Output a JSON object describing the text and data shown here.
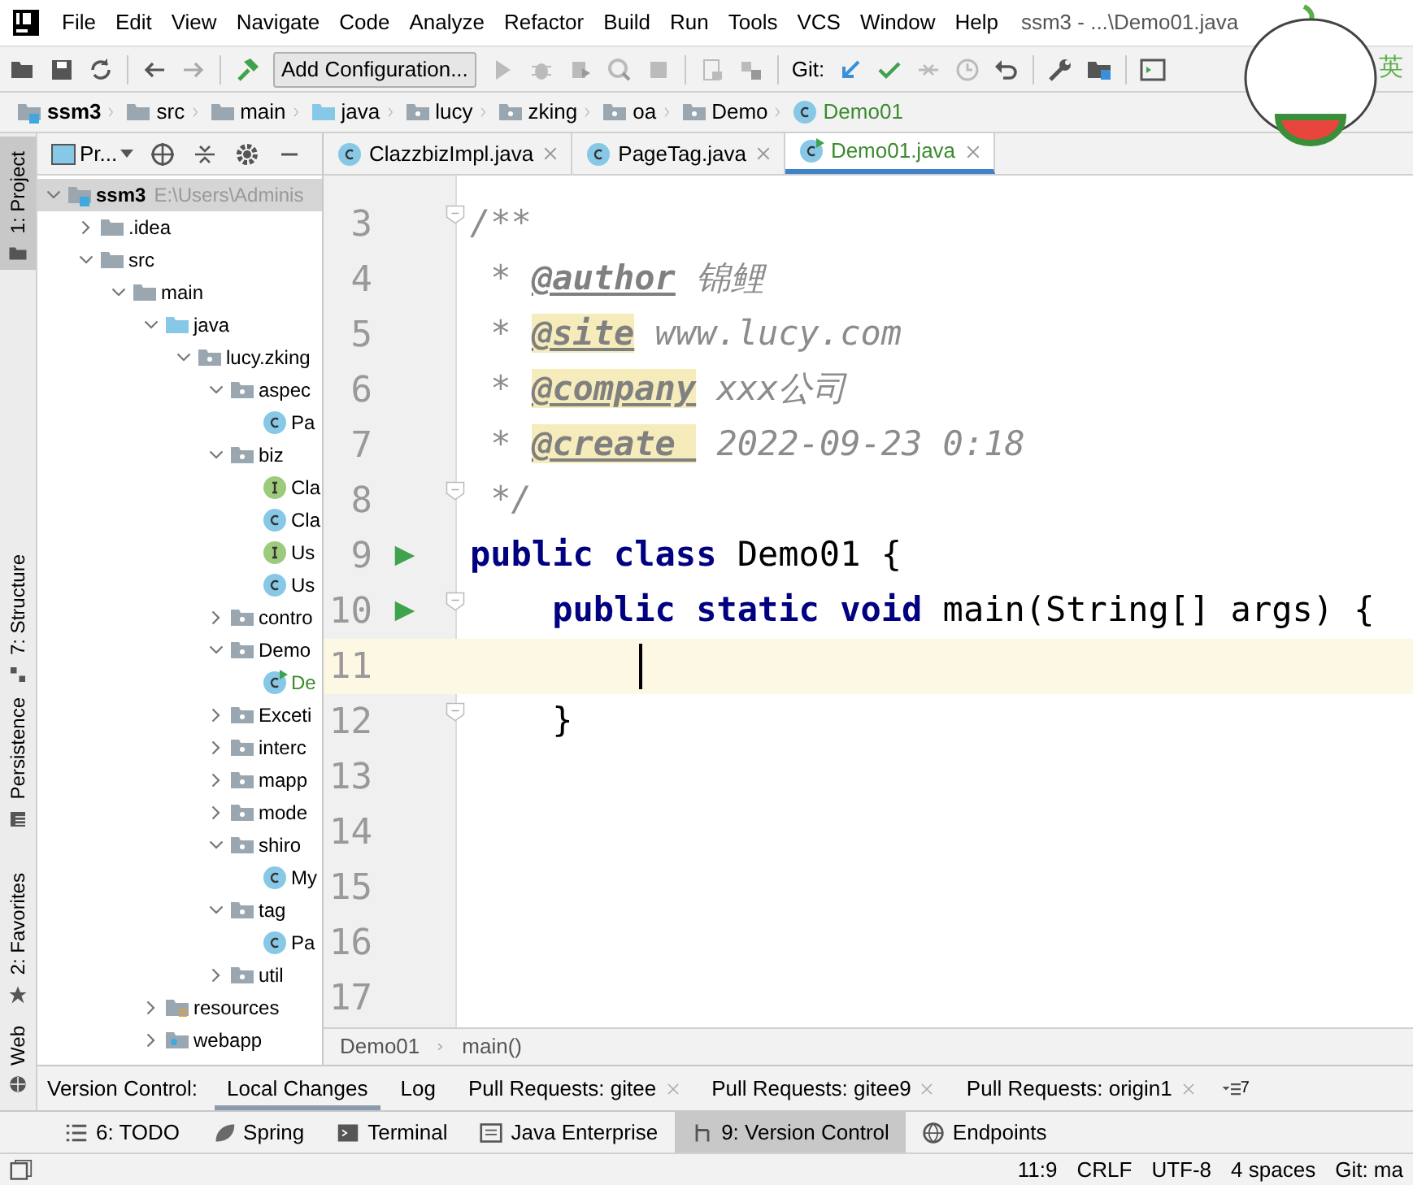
{
  "menu": [
    "File",
    "Edit",
    "View",
    "Navigate",
    "Code",
    "Analyze",
    "Refactor",
    "Build",
    "Run",
    "Tools",
    "VCS",
    "Window",
    "Help"
  ],
  "window": {
    "title": "ssm3 - ...\\Demo01.java"
  },
  "toolbar": {
    "run_config": "Add Configuration...",
    "git_label": "Git:",
    "ime": "英"
  },
  "breadcrumb": [
    {
      "label": "ssm3",
      "kind": "module"
    },
    {
      "label": "src",
      "kind": "folder"
    },
    {
      "label": "main",
      "kind": "folder"
    },
    {
      "label": "java",
      "kind": "source"
    },
    {
      "label": "lucy",
      "kind": "package"
    },
    {
      "label": "zking",
      "kind": "package"
    },
    {
      "label": "oa",
      "kind": "package"
    },
    {
      "label": "Demo",
      "kind": "package"
    },
    {
      "label": "Demo01",
      "kind": "class",
      "color": "#3c8a2e"
    }
  ],
  "side_tools": [
    {
      "label": "1: Project",
      "selected": true
    },
    {
      "label": "7: Structure",
      "selected": false
    },
    {
      "label": "Persistence",
      "selected": false
    },
    {
      "label": "2: Favorites",
      "selected": false
    },
    {
      "label": "Web",
      "selected": false
    }
  ],
  "project": {
    "title": "Pr...",
    "tree": [
      {
        "label": "ssm3",
        "path": "E:\\Users\\Adminis",
        "kind": "module",
        "expanded": true,
        "selected": true,
        "children": [
          {
            "label": ".idea",
            "kind": "folder",
            "expanded": false,
            "selected": false
          },
          {
            "label": "src",
            "kind": "folder",
            "expanded": true,
            "selected": false,
            "children": [
              {
                "label": "main",
                "kind": "folder",
                "expanded": true,
                "selected": false,
                "children": [
                  {
                    "label": "java",
                    "kind": "source",
                    "expanded": true,
                    "selected": false,
                    "children": [
                      {
                        "label": "lucy.zking",
                        "kind": "package",
                        "expanded": true,
                        "selected": false,
                        "children": [
                          {
                            "label": "aspec",
                            "kind": "package",
                            "expanded": true,
                            "selected": false,
                            "children": [
                              {
                                "label": "Pa",
                                "kind": "class",
                                "selected": false
                              }
                            ]
                          },
                          {
                            "label": "biz",
                            "kind": "package",
                            "expanded": true,
                            "selected": false,
                            "children": [
                              {
                                "label": "Cla",
                                "kind": "interface",
                                "selected": false
                              },
                              {
                                "label": "Cla",
                                "kind": "class",
                                "selected": false
                              },
                              {
                                "label": "Us",
                                "kind": "interface",
                                "selected": false
                              },
                              {
                                "label": "Us",
                                "kind": "class",
                                "selected": false
                              }
                            ]
                          },
                          {
                            "label": "contro",
                            "kind": "package",
                            "expanded": false,
                            "selected": false
                          },
                          {
                            "label": "Demo",
                            "kind": "package",
                            "expanded": true,
                            "selected": false,
                            "children": [
                              {
                                "label": "De",
                                "kind": "runclass",
                                "color": "#3c8a2e",
                                "selected": false
                              }
                            ]
                          },
                          {
                            "label": "Exceti",
                            "kind": "package",
                            "expanded": false,
                            "selected": false
                          },
                          {
                            "label": "interc",
                            "kind": "package",
                            "expanded": false,
                            "selected": false
                          },
                          {
                            "label": "mapp",
                            "kind": "package",
                            "expanded": false,
                            "selected": false
                          },
                          {
                            "label": "mode",
                            "kind": "package",
                            "expanded": false,
                            "selected": false
                          },
                          {
                            "label": "shiro",
                            "kind": "package",
                            "expanded": true,
                            "selected": false,
                            "children": [
                              {
                                "label": "My",
                                "kind": "class",
                                "selected": false
                              }
                            ]
                          },
                          {
                            "label": "tag",
                            "kind": "package",
                            "expanded": true,
                            "selected": false,
                            "children": [
                              {
                                "label": "Pa",
                                "kind": "class",
                                "selected": false
                              }
                            ]
                          },
                          {
                            "label": "util",
                            "kind": "package",
                            "expanded": false,
                            "selected": false
                          }
                        ]
                      }
                    ]
                  },
                  {
                    "label": "resources",
                    "kind": "resources",
                    "expanded": false,
                    "selected": false
                  },
                  {
                    "label": "webapp",
                    "kind": "webapp",
                    "expanded": false,
                    "selected": false
                  }
                ]
              }
            ]
          }
        ]
      }
    ]
  },
  "editor_tabs": [
    {
      "label": "ClazzbizImpl.java",
      "kind": "class",
      "selected": false
    },
    {
      "label": "PageTag.java",
      "kind": "class",
      "selected": false
    },
    {
      "label": "Demo01.java",
      "kind": "runclass",
      "color": "#3c8a2e",
      "selected": true
    }
  ],
  "code": [
    {
      "number": "3",
      "fold": true,
      "tokens": [
        {
          "kind": "comment",
          "text": "/**"
        }
      ]
    },
    {
      "number": "4",
      "tokens": [
        {
          "kind": "comment",
          "text": " * "
        },
        {
          "kind": "tag",
          "text": "@author"
        },
        {
          "kind": "comment",
          "text": " 锦鲤"
        }
      ]
    },
    {
      "number": "5",
      "tokens": [
        {
          "kind": "comment",
          "text": " * "
        },
        {
          "kind": "tag",
          "text": "@site",
          "highlighted": true
        },
        {
          "kind": "comment",
          "text": " www.lucy.com"
        }
      ]
    },
    {
      "number": "6",
      "tokens": [
        {
          "kind": "comment",
          "text": " * "
        },
        {
          "kind": "tag",
          "text": "@company",
          "highlighted": true
        },
        {
          "kind": "comment",
          "text": " xxx公司"
        }
      ]
    },
    {
      "number": "7",
      "tokens": [
        {
          "kind": "comment",
          "text": " * "
        },
        {
          "kind": "tag",
          "text": "@create ",
          "highlighted": true
        },
        {
          "kind": "comment",
          "text": " 2022-09-23 0:18"
        }
      ]
    },
    {
      "number": "8",
      "fold": true,
      "tokens": [
        {
          "kind": "comment",
          "text": " */"
        }
      ]
    },
    {
      "number": "9",
      "run": true,
      "tokens": [
        {
          "kind": "keyword",
          "text": "public class"
        },
        {
          "kind": "plain",
          "text": " Demo01 {"
        }
      ]
    },
    {
      "number": "10",
      "run": true,
      "fold": true,
      "tokens": [
        {
          "kind": "keyword",
          "text": "    public static void"
        },
        {
          "kind": "plain",
          "text": " main(String[] args) {"
        }
      ]
    },
    {
      "number": "11",
      "current": true
    },
    {
      "number": "12",
      "fold": true,
      "tokens": [
        {
          "kind": "plain",
          "text": "    }"
        }
      ]
    },
    {
      "number": "13"
    },
    {
      "number": "14"
    },
    {
      "number": "15"
    },
    {
      "number": "16"
    },
    {
      "number": "17"
    }
  ],
  "editor_breadcrumb": [
    "Demo01",
    "main()"
  ],
  "vc_tabs": {
    "label": "Version Control:",
    "overflow": "7",
    "tabs": [
      {
        "label": "Local Changes",
        "closable": false,
        "selected": true
      },
      {
        "label": "Log",
        "closable": false,
        "selected": false
      },
      {
        "label": "Pull Requests: gitee",
        "closable": true,
        "selected": false
      },
      {
        "label": "Pull Requests: gitee9",
        "closable": true,
        "selected": false
      },
      {
        "label": "Pull Requests: origin1",
        "closable": true,
        "selected": false
      }
    ]
  },
  "tool_windows": [
    {
      "label": "6: TODO",
      "kind": "todo",
      "selected": false
    },
    {
      "label": "Spring",
      "kind": "spring",
      "selected": false
    },
    {
      "label": "Terminal",
      "kind": "terminal",
      "selected": false
    },
    {
      "label": "Java Enterprise",
      "kind": "enterprise",
      "selected": false
    },
    {
      "label": "9: Version Control",
      "kind": "vcs",
      "selected": true
    },
    {
      "label": "Endpoints",
      "kind": "endpoints",
      "selected": false
    }
  ],
  "status_bar": [
    "11:9",
    "CRLF",
    "UTF-8",
    "4 spaces",
    "Git: ma"
  ]
}
